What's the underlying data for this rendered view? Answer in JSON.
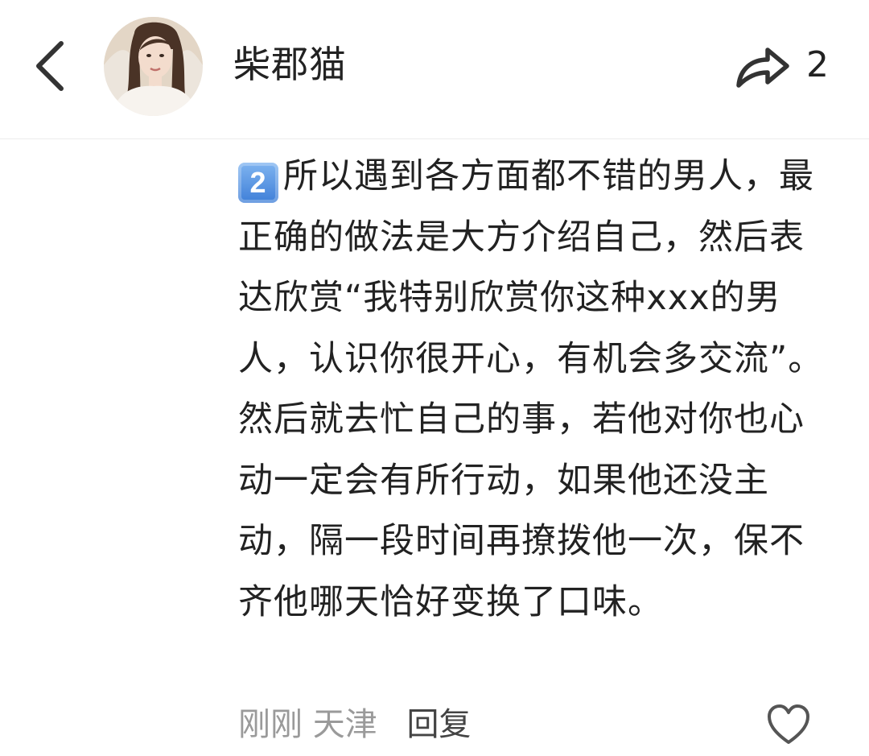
{
  "header": {
    "username": "柴郡猫",
    "share_count": "2",
    "icons": {
      "back": "chevron-left-icon",
      "share": "share-arrow-icon"
    }
  },
  "comment": {
    "number_badge": "2",
    "text": "所以遇到各方面都不错的男人，最正确的做法是大方介绍自己，然后表达欣赏“我特别欣赏你这种xxx的男人，认识你很开心，有机会多交流”。然后就去忙自己的事，若他对你也心动一定会有所行动，如果他还没主动，隔一段时间再撩拨他一次，保不齐他哪天恰好变换了口味。"
  },
  "footer": {
    "time": "刚刚",
    "location": "天津",
    "reply_label": "回复",
    "like_icon": "heart-outline-icon"
  }
}
